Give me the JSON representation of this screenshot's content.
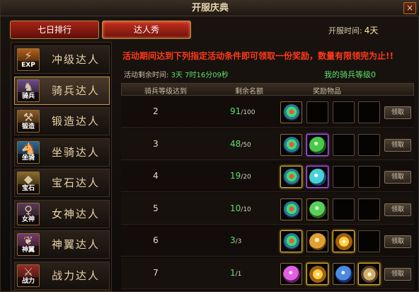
{
  "window": {
    "title": "开服庆典",
    "close_label": "×"
  },
  "tabs": [
    {
      "label": "七日排行",
      "active": false
    },
    {
      "label": "达人秀",
      "active": true
    }
  ],
  "open_time": {
    "label": "开服时间:",
    "value": "4天"
  },
  "sidebar": {
    "items": [
      {
        "label": "冲级达人",
        "icon": "exp-icon",
        "icon_cap": "EXP",
        "glyph": "⚡",
        "color": "#b8601a",
        "active": false
      },
      {
        "label": "骑兵达人",
        "icon": "cavalry-icon",
        "icon_cap": "骑兵",
        "glyph": "♞",
        "color": "#6a4a8a",
        "active": true
      },
      {
        "label": "锻造达人",
        "icon": "forge-icon",
        "icon_cap": "锻造",
        "glyph": "⚒",
        "color": "#8a5a2a",
        "active": false
      },
      {
        "label": "坐骑达人",
        "icon": "mount-icon",
        "icon_cap": "坐骑",
        "glyph": "🐴",
        "color": "#2a6a9a",
        "active": false
      },
      {
        "label": "宝石达人",
        "icon": "gem-icon",
        "icon_cap": "宝石",
        "glyph": "◆",
        "color": "#8a6a2a",
        "active": false
      },
      {
        "label": "女神达人",
        "icon": "goddess-icon",
        "icon_cap": "女神",
        "glyph": "♀",
        "color": "#5a3a5a",
        "active": false
      },
      {
        "label": "神翼达人",
        "icon": "wing-icon",
        "icon_cap": "神翼",
        "glyph": "❦",
        "color": "#7a3a6a",
        "active": false
      },
      {
        "label": "战力达人",
        "icon": "power-icon",
        "icon_cap": "战力",
        "glyph": "⚔",
        "color": "#9a2a2a",
        "active": false
      }
    ]
  },
  "notice": "活动期间达到下列指定活动条件即可领取一份奖励，数量有限领完为止!!",
  "countdown": {
    "label": "活动剩余时间:",
    "value": "3天 7时16分09秒"
  },
  "my_level": "我的骑兵等级0",
  "table": {
    "headers": {
      "level": "骑兵等级达到",
      "remaining": "剩余名额",
      "reward": "奖励物品"
    },
    "claim_label": "领取",
    "rows": [
      {
        "level": "2",
        "remaining": "91",
        "total": "/100",
        "rewards": [
          {
            "icon": "emblem-icon",
            "art": "it-emblem",
            "frame": "filled"
          },
          null,
          null,
          null
        ]
      },
      {
        "level": "3",
        "remaining": "48",
        "total": "/50",
        "rewards": [
          {
            "icon": "emblem-icon",
            "art": "it-emblem",
            "frame": "filled"
          },
          {
            "icon": "leaf-icon",
            "art": "it-leaf",
            "frame": "purple"
          },
          null,
          null
        ]
      },
      {
        "level": "4",
        "remaining": "19",
        "total": "/20",
        "rewards": [
          {
            "icon": "emblem-icon",
            "art": "it-emblem",
            "frame": "gold"
          },
          {
            "icon": "feather-icon",
            "art": "it-feather",
            "frame": "purple"
          },
          null,
          null
        ]
      },
      {
        "level": "5",
        "remaining": "10",
        "total": "/10",
        "rewards": [
          {
            "icon": "emblem-icon",
            "art": "it-emblem",
            "frame": "filled"
          },
          {
            "icon": "green-orb-icon",
            "art": "it-orb-green",
            "frame": "filled"
          },
          null,
          null
        ]
      },
      {
        "level": "6",
        "remaining": "3",
        "total": "/3",
        "rewards": [
          {
            "icon": "emblem-icon",
            "art": "it-emblem",
            "frame": "gold"
          },
          {
            "icon": "coin-icon",
            "art": "it-coin",
            "frame": "filled"
          },
          {
            "icon": "sun-icon",
            "art": "it-sun",
            "frame": "gold"
          },
          null
        ]
      },
      {
        "level": "7",
        "remaining": "1",
        "total": "/1",
        "rewards": [
          {
            "icon": "pink-orb-icon",
            "art": "it-pink",
            "frame": "filled"
          },
          {
            "icon": "sun-icon",
            "art": "it-sun",
            "frame": "gold"
          },
          {
            "icon": "blue-orb-icon",
            "art": "it-blue",
            "frame": "filled"
          },
          {
            "icon": "flower-icon",
            "art": "it-flower",
            "frame": "gold"
          }
        ]
      }
    ]
  }
}
